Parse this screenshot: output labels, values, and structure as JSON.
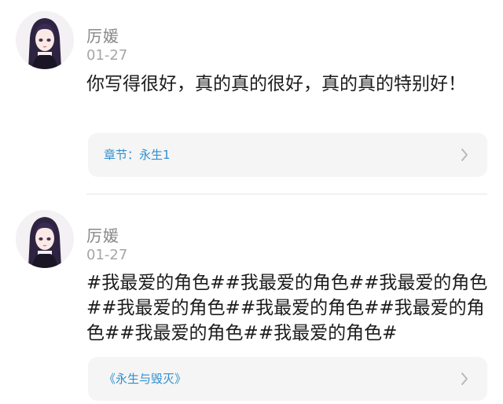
{
  "comments": [
    {
      "user": "厉媛",
      "date": "01-27",
      "text": "你写得很好，真的真的很好，真的真的特别好！",
      "chapter": "章节：永生1",
      "chevron_icon": "chevron-right-icon"
    },
    {
      "user": "厉媛",
      "date": "01-27",
      "text": "#我最爱的角色##我最爱的角色##我最爱的角色##我最爱的角色##我最爱的角色##我最爱的角色##我最爱的角色##我最爱的角色#",
      "chapter": "《永生与毁灭》",
      "chevron_icon": "chevron-right-icon"
    }
  ],
  "colors": {
    "link_blue": "#2f8fcf",
    "meta_gray": "#a6a6a6",
    "card_bg": "#f5f5f5"
  }
}
